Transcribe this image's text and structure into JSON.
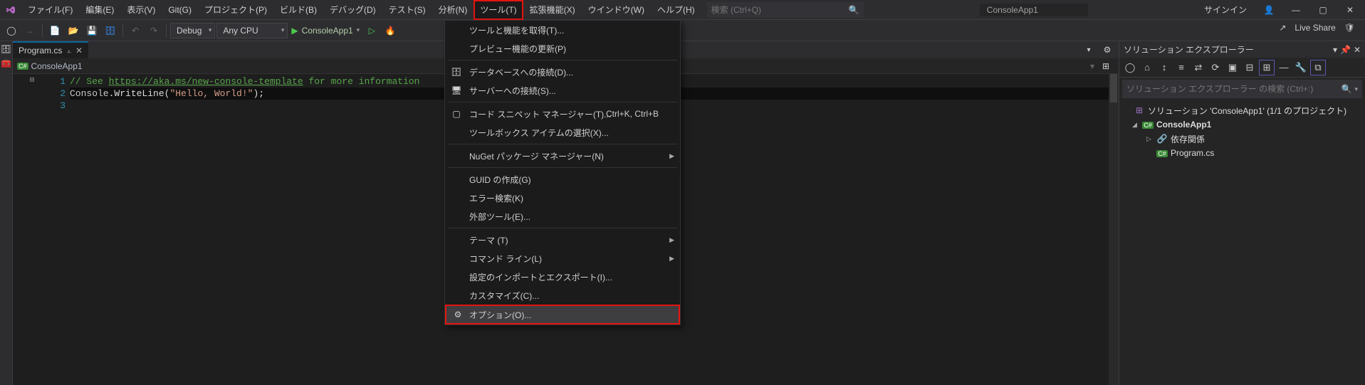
{
  "menu": {
    "file": "ファイル(F)",
    "edit": "編集(E)",
    "view": "表示(V)",
    "git": "Git(G)",
    "project": "プロジェクト(P)",
    "build": "ビルド(B)",
    "debug": "デバッグ(D)",
    "test": "テスト(S)",
    "analyze": "分析(N)",
    "tools": "ツール(T)",
    "extensions": "拡張機能(X)",
    "window": "ウインドウ(W)",
    "help": "ヘルプ(H)"
  },
  "search": {
    "placeholder": "検索 (Ctrl+Q)"
  },
  "project_name": "ConsoleApp1",
  "signin": "サインイン",
  "toolbar": {
    "config": "Debug",
    "platform": "Any CPU",
    "start_target": "ConsoleApp1"
  },
  "live_share": "Live Share",
  "tabs": {
    "file": "Program.cs"
  },
  "breadcrumb": {
    "item0": "ConsoleApp1"
  },
  "code": {
    "lines": [
      "1",
      "2",
      "3"
    ],
    "comment_prefix": "// See ",
    "link": "https://aka.ms/new-console-template",
    "comment_suffix": " for more information",
    "line2_obj": "Console",
    "line2_method": ".WriteLine(",
    "line2_str": "\"Hello, World!\"",
    "line2_end": ");"
  },
  "solution_explorer": {
    "title": "ソリューション エクスプローラー",
    "search_placeholder": "ソリューション エクスプローラー の検索 (Ctrl+:)",
    "solution": "ソリューション 'ConsoleApp1' (1/1 のプロジェクト)",
    "project": "ConsoleApp1",
    "deps": "依存関係",
    "program": "Program.cs",
    "cs_badge": "C#"
  },
  "tools_menu": {
    "get_tools": "ツールと機能を取得(T)...",
    "preview_update": "プレビュー機能の更新(P)",
    "db_connect": "データベースへの接続(D)...",
    "server_connect": "サーバーへの接続(S)...",
    "code_snippet": "コード スニペット マネージャー(T)...",
    "code_snippet_shortcut": "Ctrl+K, Ctrl+B",
    "toolbox": "ツールボックス アイテムの選択(X)...",
    "nuget": "NuGet パッケージ マネージャー(N)",
    "guid": "GUID の作成(G)",
    "error_search": "エラー検索(K)",
    "external_tools": "外部ツール(E)...",
    "theme": "テーマ (T)",
    "command_line": "コマンド ライン(L)",
    "import_export": "設定のインポートとエクスポート(I)...",
    "customize": "カスタマイズ(C)...",
    "options": "オプション(O)..."
  }
}
